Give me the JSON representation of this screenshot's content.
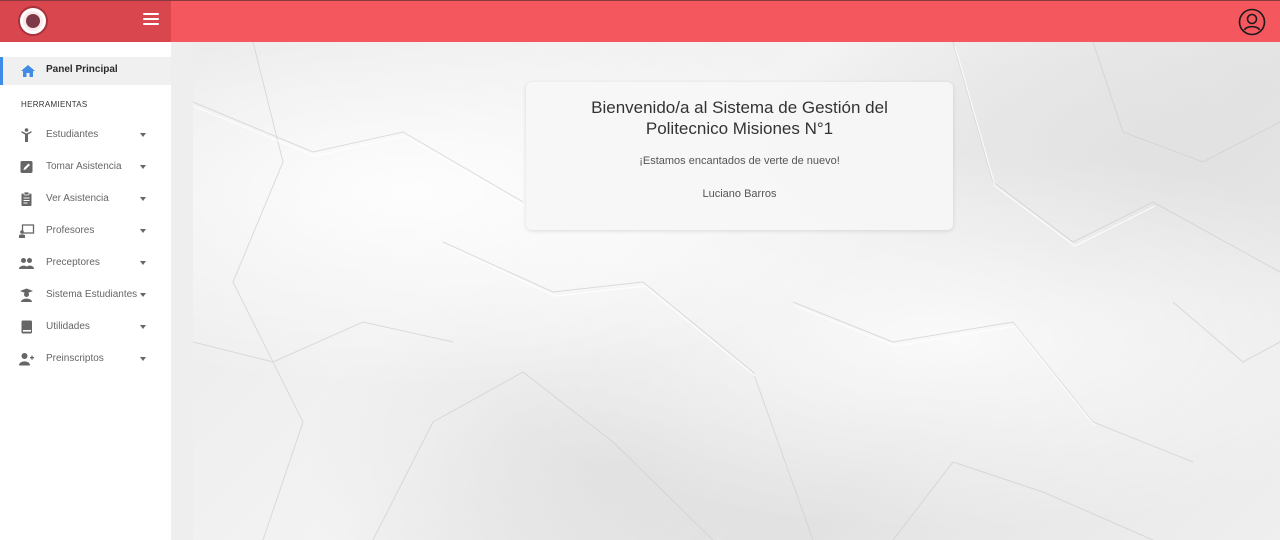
{
  "header": {
    "logo_icon": "school-seal-icon",
    "menu_icon": "hamburger-menu-icon",
    "user_icon": "user-circle-icon",
    "accent_color": "#f5575f"
  },
  "sidebar": {
    "active_item": {
      "label": "Panel Principal",
      "icon": "home-icon"
    },
    "section_title": "HERRAMIENTAS",
    "items": [
      {
        "label": "Estudiantes",
        "icon": "student-icon"
      },
      {
        "label": "Tomar Asistencia",
        "icon": "edit-icon"
      },
      {
        "label": "Ver Asistencia",
        "icon": "clipboard-icon"
      },
      {
        "label": "Profesores",
        "icon": "teacher-board-icon"
      },
      {
        "label": "Preceptores",
        "icon": "users-icon"
      },
      {
        "label": "Sistema Estudiantes",
        "icon": "graduate-icon"
      },
      {
        "label": "Utilidades",
        "icon": "book-icon"
      },
      {
        "label": "Preinscriptos",
        "icon": "user-plus-icon"
      }
    ]
  },
  "main": {
    "welcome_line1": "Bienvenido/a al Sistema de Gestión del",
    "welcome_line2": "Politecnico Misiones N°1",
    "subtitle": "¡Estamos encantados de verte de nuevo!",
    "user_name": "Luciano Barros"
  }
}
